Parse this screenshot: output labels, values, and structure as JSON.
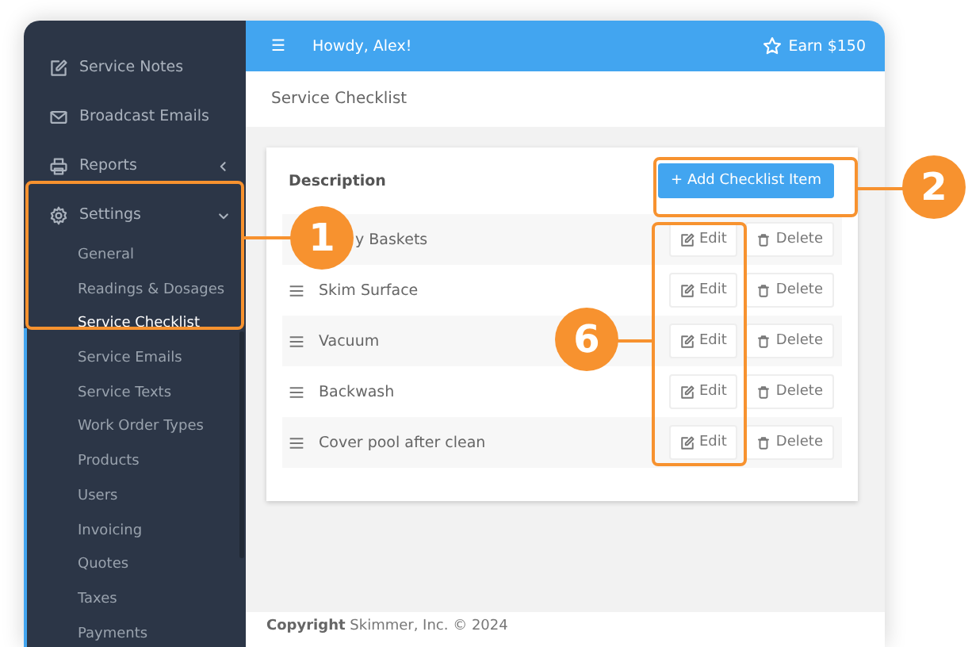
{
  "header": {
    "menu_glyph": "☰",
    "greeting": "Howdy, Alex!",
    "reward": "Earn $150"
  },
  "sidebar": {
    "items": [
      {
        "label": "Service Notes"
      },
      {
        "label": "Broadcast Emails"
      },
      {
        "label": "Reports",
        "expanded": false
      },
      {
        "label": "Settings",
        "expanded": true,
        "children": [
          {
            "label": "General",
            "selected": false
          },
          {
            "label": "Readings & Dosages",
            "selected": false
          },
          {
            "label": "Service Checklist",
            "selected": true
          },
          {
            "label": "Service Emails",
            "selected": false
          },
          {
            "label": "Service Texts",
            "selected": false
          },
          {
            "label": "Work Order Types",
            "selected": false
          },
          {
            "label": "Products",
            "selected": false
          },
          {
            "label": "Users",
            "selected": false
          },
          {
            "label": "Invoicing",
            "selected": false
          },
          {
            "label": "Quotes",
            "selected": false
          },
          {
            "label": "Taxes",
            "selected": false
          },
          {
            "label": "Payments",
            "selected": false
          }
        ]
      }
    ]
  },
  "page_title": "Service Checklist",
  "table": {
    "column": "Description",
    "add_button": "+ Add Checklist Item",
    "rows": [
      {
        "description": "y Baskets",
        "obscured": true,
        "edit": "Edit",
        "delete": "Delete"
      },
      {
        "description": "Skim Surface",
        "edit": "Edit",
        "delete": "Delete"
      },
      {
        "description": "Vacuum",
        "edit": "Edit",
        "delete": "Delete"
      },
      {
        "description": "Backwash",
        "edit": "Edit",
        "delete": "Delete"
      },
      {
        "description": "Cover pool after clean",
        "edit": "Edit",
        "delete": "Delete"
      }
    ]
  },
  "footer": "**Copyright** Skimmer, Inc. © 2024",
  "callouts": [
    {
      "number": "1"
    },
    {
      "number": "2"
    },
    {
      "number": "6"
    }
  ]
}
